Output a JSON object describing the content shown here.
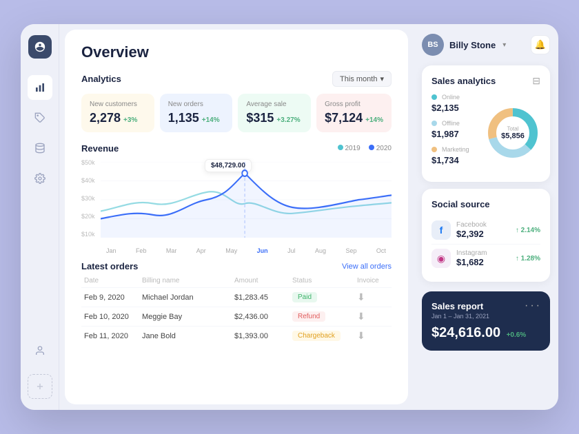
{
  "sidebar": {
    "logo_initials": "p",
    "nav_items": [
      {
        "icon": "chart-icon",
        "label": "Analytics",
        "active": true
      },
      {
        "icon": "tag-icon",
        "label": "Orders"
      },
      {
        "icon": "database-icon",
        "label": "Products"
      },
      {
        "icon": "settings-icon",
        "label": "Settings"
      },
      {
        "icon": "user-icon",
        "label": "Profile"
      }
    ],
    "add_button": "+"
  },
  "header": {
    "page_title": "Overview"
  },
  "analytics": {
    "section_label": "Analytics",
    "month_selector": "This month",
    "stats": [
      {
        "label": "New customers",
        "value": "2,278",
        "change": "+3%",
        "color": "yellow"
      },
      {
        "label": "New orders",
        "value": "1,135",
        "change": "+14%",
        "color": "blue"
      },
      {
        "label": "Average sale",
        "value": "$315",
        "change": "+3.27%",
        "color": "green"
      },
      {
        "label": "Gross profit",
        "value": "$7,124",
        "change": "+14%",
        "color": "pink"
      }
    ]
  },
  "revenue": {
    "section_label": "Revenue",
    "legend_2019": "2019",
    "legend_2020": "2020",
    "tooltip_value": "$48,729.00",
    "y_labels": [
      "$50k",
      "$40k",
      "$30k",
      "$20k",
      "$10k"
    ],
    "x_labels": [
      "Jan",
      "Feb",
      "Mar",
      "Apr",
      "May",
      "Jun",
      "Jul",
      "Aug",
      "Sep",
      "Oct"
    ]
  },
  "latest_orders": {
    "section_label": "Latest orders",
    "view_all_label": "View all orders",
    "columns": [
      "Date",
      "Billing name",
      "Amount",
      "Status",
      "Invoice"
    ],
    "rows": [
      {
        "date": "Feb 9, 2020",
        "name": "Michael Jordan",
        "amount": "$1,283.45",
        "status": "Paid",
        "status_type": "paid"
      },
      {
        "date": "Feb 10, 2020",
        "name": "Meggie Bay",
        "amount": "$2,436.00",
        "status": "Refund",
        "status_type": "refund"
      },
      {
        "date": "Feb 11, 2020",
        "name": "Jane Bold",
        "amount": "$1,393.00",
        "status": "Chargeback",
        "status_type": "chargeback"
      }
    ]
  },
  "user": {
    "name": "Billy Stone",
    "initials": "BS"
  },
  "sales_analytics": {
    "title": "Sales analytics",
    "items": [
      {
        "label": "Online",
        "value": "$2,135",
        "color": "#4fc3d0",
        "percent": 37
      },
      {
        "label": "Offline",
        "value": "$1,987",
        "color": "#a8d8ea",
        "percent": 34
      },
      {
        "label": "Marketing",
        "value": "$1,734",
        "color": "#f0c080",
        "percent": 29
      }
    ],
    "total_label": "Total",
    "total_value": "$5,856"
  },
  "social_source": {
    "title": "Social source",
    "sources": [
      {
        "platform": "Facebook",
        "value": "$2,392",
        "change": "2.14%",
        "icon": "f",
        "color": "fb"
      },
      {
        "platform": "Instagram",
        "value": "$1,682",
        "change": "1.28%",
        "icon": "◎",
        "color": "ig"
      }
    ]
  },
  "sales_report": {
    "title": "Sales report",
    "date_range": "Jan 1 – Jan 31, 2021",
    "value": "$24,616.00",
    "change": "+0.6%"
  }
}
